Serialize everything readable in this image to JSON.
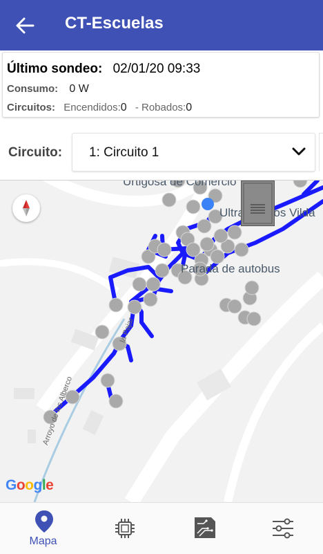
{
  "appbar": {
    "title": "CT-Escuelas",
    "back_icon": "arrow-left-icon"
  },
  "status": {
    "last_poll_label": "Último sondeo:",
    "last_poll_value": "02/01/20 09:33",
    "consumption_label": "Consumo:",
    "consumption_value": "0 W",
    "circuits_label": "Circuitos:",
    "on_label": "Encendidos:",
    "on_value": "0",
    "stolen_label": "- Robados:",
    "stolen_value": "0"
  },
  "circuit": {
    "label": "Circuito:",
    "selected": "1: Circuito 1"
  },
  "map": {
    "place_top": "Urtigosa de Comercio",
    "place_shop": "Ultramarinos Vilda",
    "bus_stop": "Parada de autobus",
    "street_1": "Arroyo de los Alberco",
    "street_2": "la Pajar",
    "attribution": "Google",
    "colors": {
      "network": "#1a1aff",
      "node": "#a9a9a9"
    }
  },
  "bottom_nav": [
    {
      "label": "Mapa",
      "icon": "map-pin-icon",
      "active": true
    },
    {
      "label": "",
      "icon": "chip-icon"
    },
    {
      "label": "",
      "icon": "circuit-board-icon"
    },
    {
      "label": "",
      "icon": "sliders-icon"
    }
  ],
  "colors": {
    "primary": "#3f51b5"
  }
}
